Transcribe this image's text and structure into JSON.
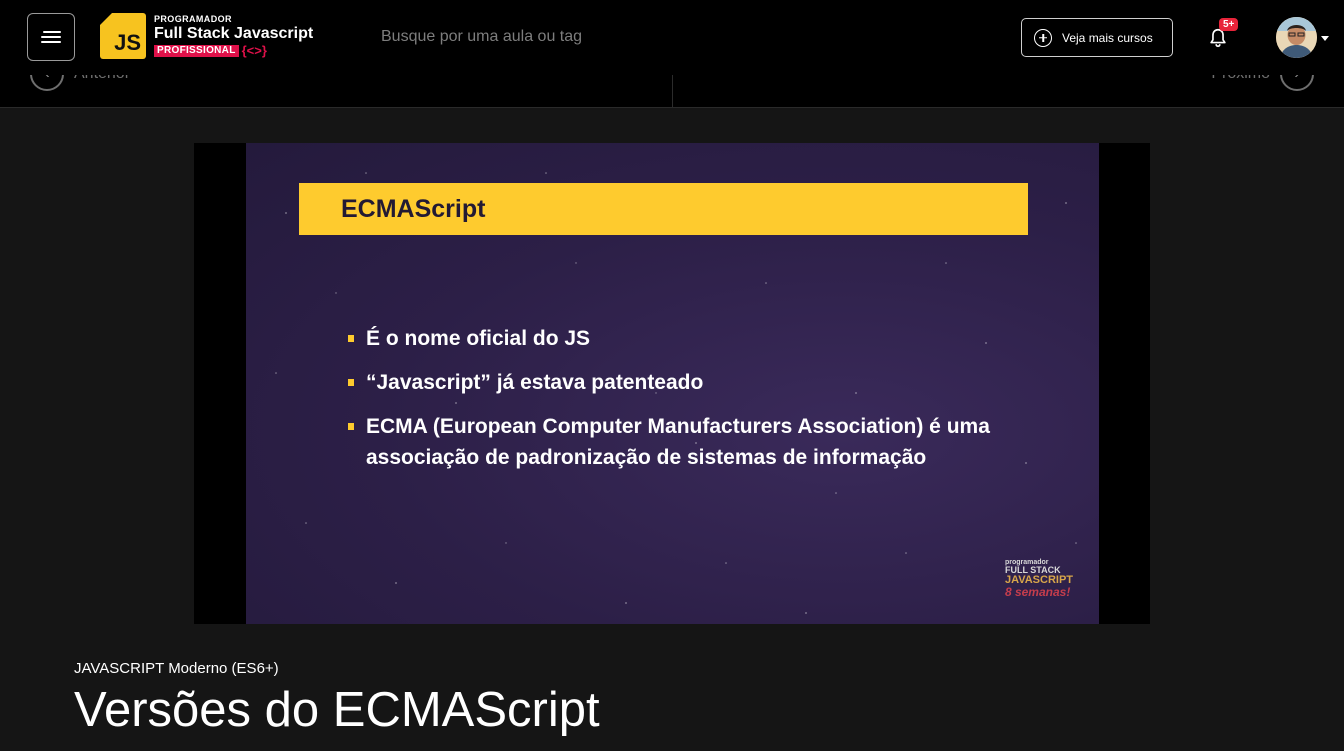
{
  "header": {
    "logo": {
      "badge": "JS",
      "top_text": "PROGRAMADOR",
      "main_text": "Full Stack Javascript",
      "pro_text": "PROFISSIONAL",
      "brace_text": "{<>}"
    },
    "search_placeholder": "Busque por uma aula ou tag",
    "cursos_button_label": "Veja mais cursos",
    "notification_badge": "5+"
  },
  "nav": {
    "prev_label": "Anterior",
    "next_label": "Próximo"
  },
  "slide": {
    "title": "ECMAScript",
    "bullets": [
      "É o nome oficial do JS",
      "“Javascript” já estava patenteado",
      "ECMA (European Computer Manufacturers Association) é uma associação de padronização de sistemas de informação"
    ],
    "watermark": {
      "line1": "programador",
      "line2": "FULL STACK",
      "line3": "JAVASCRIPT",
      "line4": "8 semanas!"
    }
  },
  "course": {
    "category": "JAVASCRIPT Moderno (ES6+)",
    "lesson_title": "Versões do ECMAScript"
  },
  "colors": {
    "accent_yellow": "#fecb2e",
    "slide_bg": "#2c1f47",
    "badge_red": "#e8243a",
    "pro_red": "#e0114a"
  }
}
